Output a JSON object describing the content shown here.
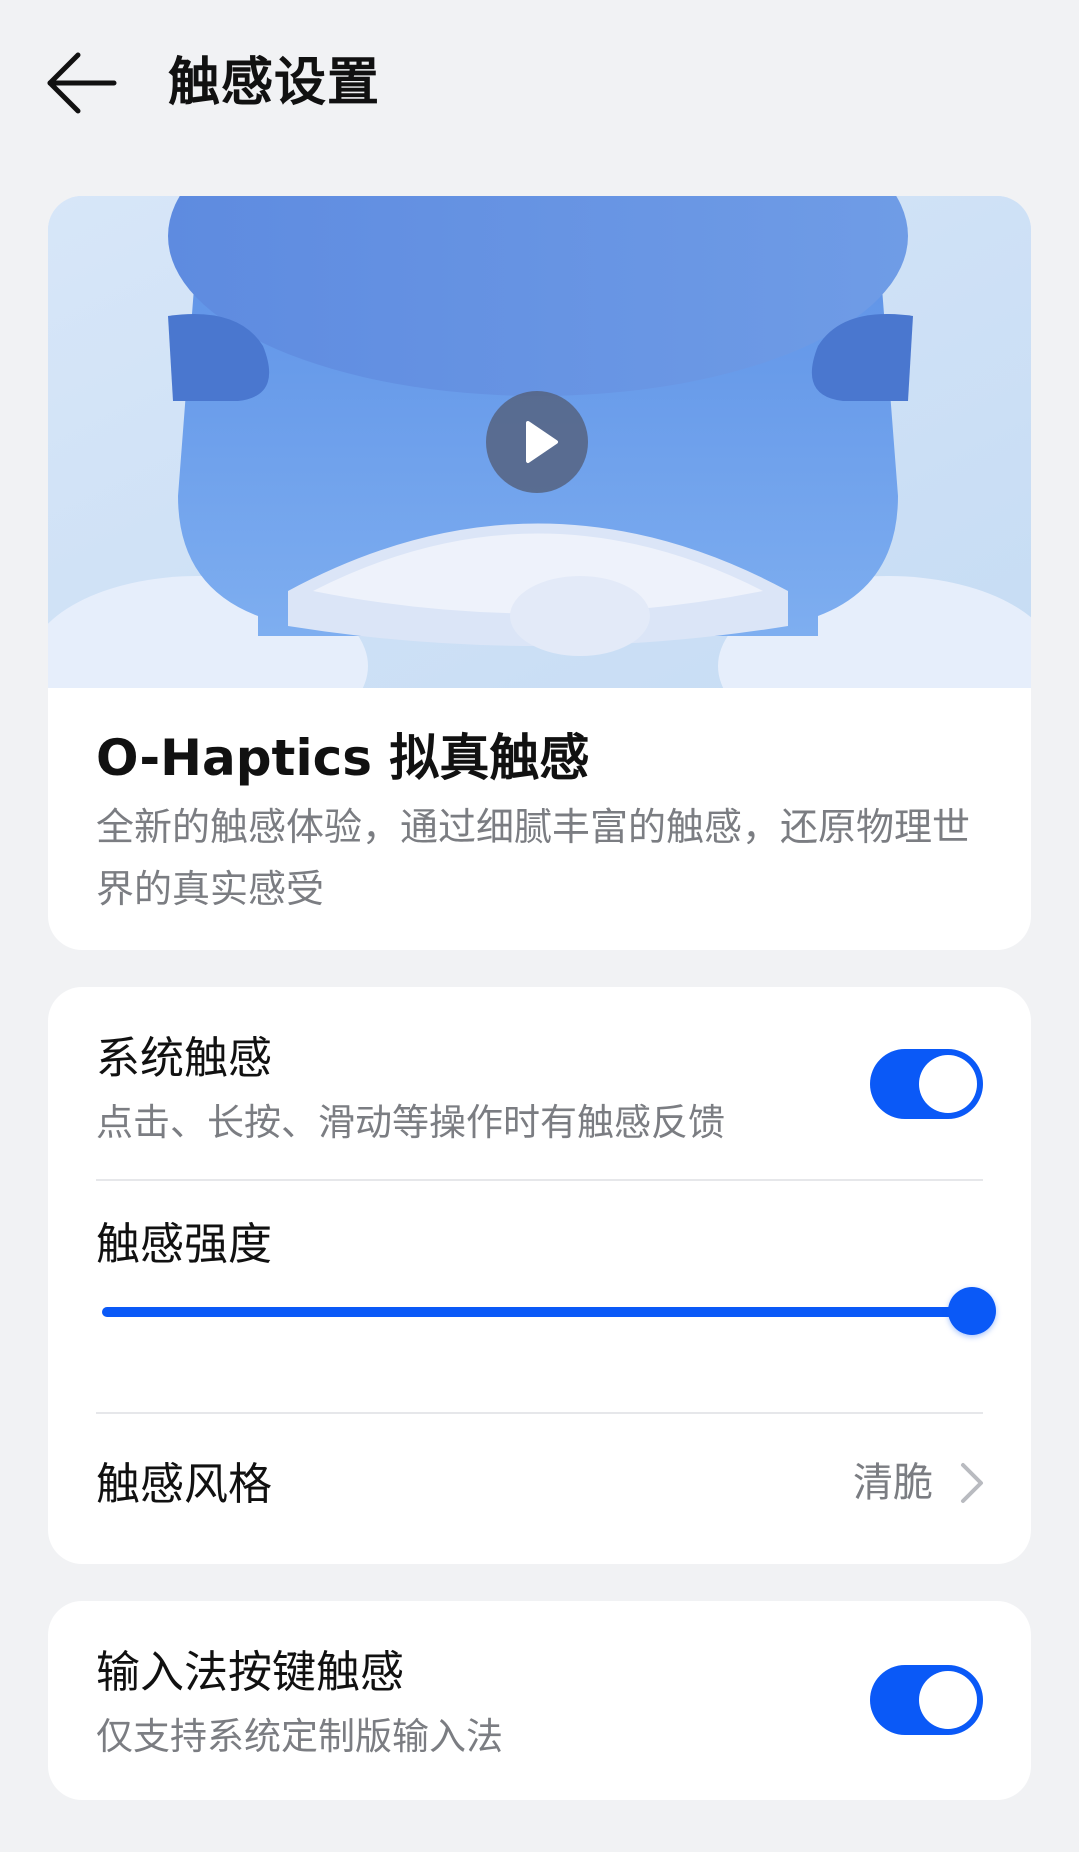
{
  "header": {
    "title": "触感设置"
  },
  "hero": {
    "title": "O-Haptics 拟真触感",
    "description": "全新的触感体验，通过细腻丰富的触感，还原物理世界的真实感受"
  },
  "settings": {
    "system_haptics": {
      "title": "系统触感",
      "subtitle": "点击、长按、滑动等操作时有触感反馈",
      "enabled": true
    },
    "intensity": {
      "title": "触感强度",
      "value_fraction": 1.0
    },
    "style": {
      "title": "触感风格",
      "value": "清脆"
    }
  },
  "ime": {
    "title": "输入法按键触感",
    "subtitle": "仅支持系统定制版输入法",
    "enabled": true
  },
  "colors": {
    "accent": "#0a59f7",
    "background": "#f1f2f4",
    "card": "#ffffff",
    "secondary_text": "#7b7d82"
  }
}
